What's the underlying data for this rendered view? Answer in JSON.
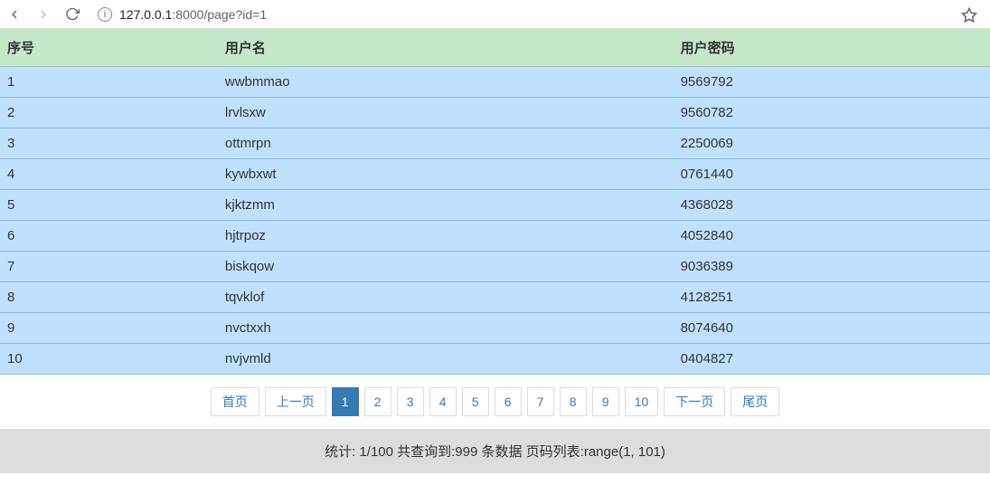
{
  "browser": {
    "url_host": "127.0.0.1",
    "url_port": ":8000",
    "url_path": "/page?id=1"
  },
  "table": {
    "headers": {
      "id": "序号",
      "username": "用户名",
      "password": "用户密码"
    },
    "rows": [
      {
        "id": "1",
        "username": "wwbmmao",
        "password": "9569792"
      },
      {
        "id": "2",
        "username": "lrvlsxw",
        "password": "9560782"
      },
      {
        "id": "3",
        "username": "ottmrpn",
        "password": "2250069"
      },
      {
        "id": "4",
        "username": "kywbxwt",
        "password": "0761440"
      },
      {
        "id": "5",
        "username": "kjktzmm",
        "password": "4368028"
      },
      {
        "id": "6",
        "username": "hjtrpoz",
        "password": "4052840"
      },
      {
        "id": "7",
        "username": "biskqow",
        "password": "9036389"
      },
      {
        "id": "8",
        "username": "tqvklof",
        "password": "4128251"
      },
      {
        "id": "9",
        "username": "nvctxxh",
        "password": "8074640"
      },
      {
        "id": "10",
        "username": "nvjvmld",
        "password": "0404827"
      }
    ]
  },
  "pagination": {
    "first": "首页",
    "prev": "上一页",
    "pages": [
      "1",
      "2",
      "3",
      "4",
      "5",
      "6",
      "7",
      "8",
      "9",
      "10"
    ],
    "active_index": 0,
    "next": "下一页",
    "last": "尾页"
  },
  "stats": {
    "text": "统计: 1/100 共查询到:999 条数据 页码列表:range(1, 101)"
  }
}
